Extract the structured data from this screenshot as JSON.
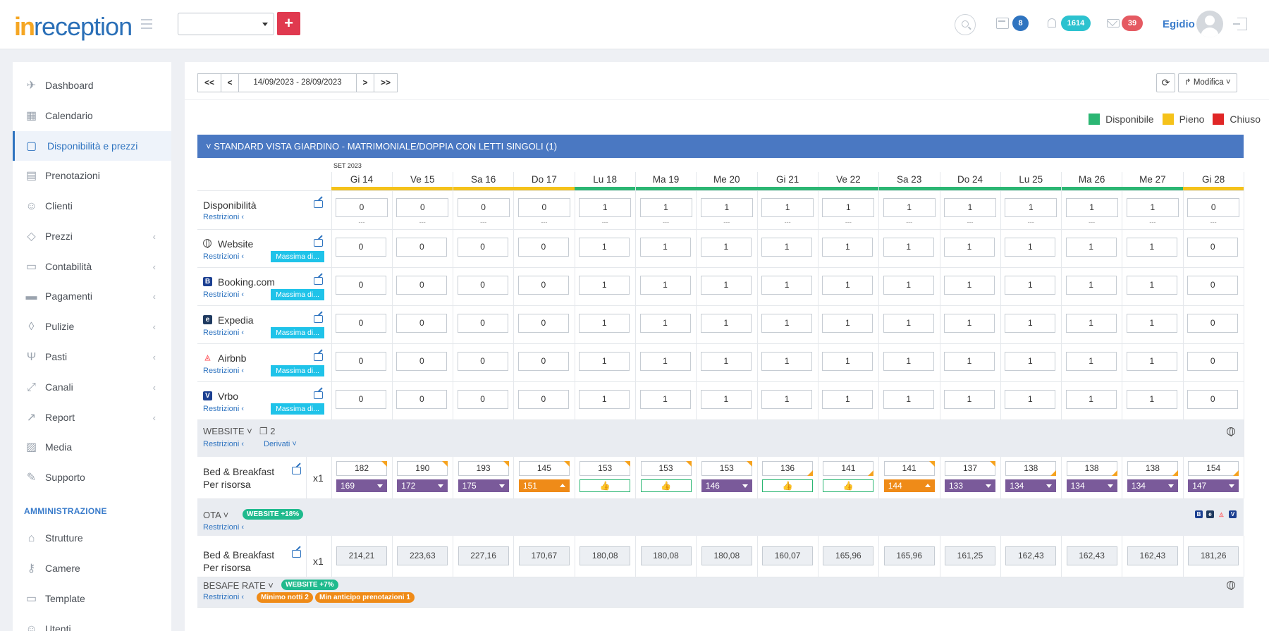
{
  "brand": {
    "logo_in": "in",
    "logo_rest": "reception"
  },
  "header": {
    "property_select": "",
    "add_label": "+",
    "calendar_badge": "8",
    "notifications_badge": "1614",
    "messages_badge": "39",
    "username": "Egidio"
  },
  "sidebar": {
    "items": [
      {
        "label": "Dashboard",
        "icon": "rocket-icon",
        "glyph": "✈",
        "chevron": false
      },
      {
        "label": "Calendario",
        "icon": "calendar-icon",
        "glyph": "▦",
        "chevron": false
      },
      {
        "label": "Disponibilità e prezzi",
        "icon": "calendar-check-icon",
        "glyph": "▢",
        "chevron": false,
        "active": true
      },
      {
        "label": "Prenotazioni",
        "icon": "document-icon",
        "glyph": "▤",
        "chevron": false
      },
      {
        "label": "Clienti",
        "icon": "user-icon",
        "glyph": "☺",
        "chevron": false
      },
      {
        "label": "Prezzi",
        "icon": "tag-icon",
        "glyph": "◇",
        "chevron": true
      },
      {
        "label": "Contabilità",
        "icon": "folder-icon",
        "glyph": "▭",
        "chevron": true
      },
      {
        "label": "Pagamenti",
        "icon": "credit-card-icon",
        "glyph": "▬",
        "chevron": true
      },
      {
        "label": "Pulizie",
        "icon": "drop-icon",
        "glyph": "◊",
        "chevron": true
      },
      {
        "label": "Pasti",
        "icon": "cutlery-icon",
        "glyph": "Ψ",
        "chevron": true
      },
      {
        "label": "Canali",
        "icon": "expand-icon",
        "glyph": "⤢",
        "chevron": true
      },
      {
        "label": "Report",
        "icon": "chart-line-icon",
        "glyph": "↗",
        "chevron": true
      },
      {
        "label": "Media",
        "icon": "image-icon",
        "glyph": "▨",
        "chevron": false
      },
      {
        "label": "Supporto",
        "icon": "pencil-icon",
        "glyph": "✎",
        "chevron": false
      }
    ],
    "section_label": "AMMINISTRAZIONE",
    "admin_items": [
      {
        "label": "Strutture",
        "icon": "home-icon",
        "glyph": "⌂"
      },
      {
        "label": "Camere",
        "icon": "key-icon",
        "glyph": "⚷"
      },
      {
        "label": "Template",
        "icon": "comment-icon",
        "glyph": "▭"
      },
      {
        "label": "Utenti",
        "icon": "users-icon",
        "glyph": "☺"
      }
    ]
  },
  "toolbar": {
    "first": "<<",
    "prev": "<",
    "date_range": "14/09/2023 - 28/09/2023",
    "next": ">",
    "last": ">>",
    "refresh": "⟳",
    "modifica": "Modifica"
  },
  "legend": [
    {
      "label": "Disponibile",
      "color": "#2bb673"
    },
    {
      "label": "Pieno",
      "color": "#f5c21a"
    },
    {
      "label": "Chiuso",
      "color": "#e02626"
    }
  ],
  "room": {
    "title": "STANDARD VISTA GIARDINO - MATRIMONIALE/DOPPIA CON LETTI SINGOLI (1)",
    "month": "SET 2023",
    "days": [
      "Gi 14",
      "Ve 15",
      "Sa 16",
      "Do 17",
      "Lu 18",
      "Ma 19",
      "Me 20",
      "Gi 21",
      "Ve 22",
      "Sa 23",
      "Do 24",
      "Lu 25",
      "Ma 26",
      "Me 27",
      "Gi 28"
    ],
    "day_status": [
      "full",
      "full",
      "full",
      "full",
      "available",
      "available",
      "available",
      "available",
      "available",
      "available",
      "available",
      "available",
      "available",
      "available",
      "full"
    ],
    "availability": {
      "label": "Disponibilità",
      "sub": "Restrizioni",
      "dots": "---",
      "values": [
        "0",
        "0",
        "0",
        "0",
        "1",
        "1",
        "1",
        "1",
        "1",
        "1",
        "1",
        "1",
        "1",
        "1",
        "0"
      ]
    },
    "channels": [
      {
        "label": "Website",
        "icon": "globe-icon",
        "sub": "Restrizioni",
        "massima": "Massima di...",
        "values": [
          "0",
          "0",
          "0",
          "0",
          "1",
          "1",
          "1",
          "1",
          "1",
          "1",
          "1",
          "1",
          "1",
          "1",
          "0"
        ]
      },
      {
        "label": "Booking.com",
        "icon": "booking-icon",
        "glyph": "B",
        "color": "#1b3f91",
        "sub": "Restrizioni",
        "massima": "Massima di...",
        "values": [
          "0",
          "0",
          "0",
          "0",
          "1",
          "1",
          "1",
          "1",
          "1",
          "1",
          "1",
          "1",
          "1",
          "1",
          "0"
        ]
      },
      {
        "label": "Expedia",
        "icon": "expedia-icon",
        "glyph": "e",
        "color": "#1f3a60",
        "sub": "Restrizioni",
        "massima": "Massima di...",
        "values": [
          "0",
          "0",
          "0",
          "0",
          "1",
          "1",
          "1",
          "1",
          "1",
          "1",
          "1",
          "1",
          "1",
          "1",
          "0"
        ]
      },
      {
        "label": "Airbnb",
        "icon": "airbnb-icon",
        "glyph": "◬",
        "color": "#ff5a5f",
        "sub": "Restrizioni",
        "massima": "Massima di...",
        "values": [
          "0",
          "0",
          "0",
          "0",
          "1",
          "1",
          "1",
          "1",
          "1",
          "1",
          "1",
          "1",
          "1",
          "1",
          "0"
        ]
      },
      {
        "label": "Vrbo",
        "icon": "vrbo-icon",
        "glyph": "V",
        "color": "#1b3f91",
        "sub": "Restrizioni",
        "massima": "Massima di...",
        "values": [
          "0",
          "0",
          "0",
          "0",
          "1",
          "1",
          "1",
          "1",
          "1",
          "1",
          "1",
          "1",
          "1",
          "1",
          "0"
        ]
      }
    ]
  },
  "website_rate": {
    "label": "WEBSITE",
    "copies": "2",
    "sub": "Restrizioni",
    "derivati": "Derivati",
    "plan_line1": "Bed & Breakfast",
    "plan_line2": "Per risorsa",
    "mult": "x1",
    "prices": [
      "182",
      "190",
      "193",
      "145",
      "153",
      "153",
      "153",
      "136",
      "141",
      "141",
      "137",
      "138",
      "138",
      "138",
      "154"
    ],
    "corner": [
      "top",
      "top",
      "top",
      "top",
      "top",
      "top",
      "top",
      "bottom",
      "bottom",
      "top",
      "top",
      "bottom",
      "bottom",
      "bottom",
      "bottom"
    ],
    "subs": [
      {
        "type": "purple",
        "value": "169"
      },
      {
        "type": "purple",
        "value": "172"
      },
      {
        "type": "purple",
        "value": "175"
      },
      {
        "type": "orange",
        "value": "151"
      },
      {
        "type": "thumb",
        "value": "👍"
      },
      {
        "type": "thumb",
        "value": "👍"
      },
      {
        "type": "purple",
        "value": "146"
      },
      {
        "type": "thumb",
        "value": "👍"
      },
      {
        "type": "thumb",
        "value": "👍"
      },
      {
        "type": "orange",
        "value": "144"
      },
      {
        "type": "purple",
        "value": "133"
      },
      {
        "type": "purple",
        "value": "134"
      },
      {
        "type": "purple",
        "value": "134"
      },
      {
        "type": "purple",
        "value": "134"
      },
      {
        "type": "purple",
        "value": "147"
      }
    ]
  },
  "ota_rate": {
    "label": "OTA",
    "pill": "WEBSITE +18%",
    "sub": "Restrizioni",
    "plan_line1": "Bed & Breakfast",
    "plan_line2": "Per risorsa",
    "mult": "x1",
    "values": [
      "214,21",
      "223,63",
      "227,16",
      "170,67",
      "180,08",
      "180,08",
      "180,08",
      "160,07",
      "165,96",
      "165,96",
      "161,25",
      "162,43",
      "162,43",
      "162,43",
      "181,26"
    ]
  },
  "besafe_rate": {
    "label": "BESAFE RATE",
    "pill": "WEBSITE +7%",
    "sub": "Restrizioni",
    "pill_min_nights": "Minimo notti 2",
    "pill_min_advance": "Min anticipo prenotazioni 1"
  }
}
